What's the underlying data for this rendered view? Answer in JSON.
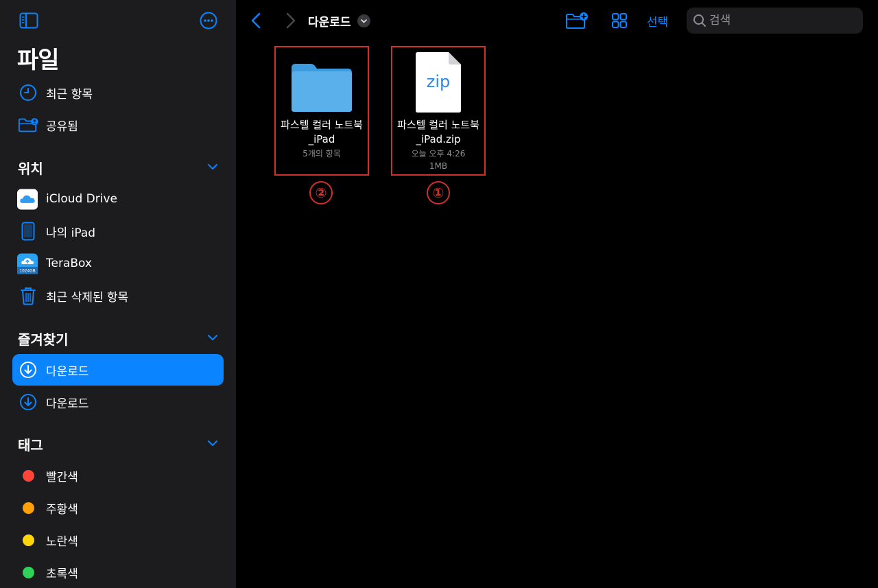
{
  "sidebar": {
    "title": "파일",
    "top_items": [
      {
        "label": "최근 항목",
        "icon": "clock-icon"
      },
      {
        "label": "공유됨",
        "icon": "shared-folder-icon"
      }
    ],
    "locations": {
      "title": "위치",
      "items": [
        {
          "label": "iCloud Drive",
          "icon": "icloud-icon"
        },
        {
          "label": "나의 iPad",
          "icon": "ipad-icon"
        },
        {
          "label": "TeraBox",
          "icon": "terabox-icon",
          "badge_text": "1024GB"
        },
        {
          "label": "최근 삭제된 항목",
          "icon": "trash-icon"
        }
      ]
    },
    "favorites": {
      "title": "즐겨찾기",
      "items": [
        {
          "label": "다운로드",
          "icon": "download-icon",
          "selected": true
        },
        {
          "label": "다운로드",
          "icon": "download-icon",
          "selected": false
        }
      ]
    },
    "tags": {
      "title": "태그",
      "items": [
        {
          "label": "빨간색",
          "color": "#ff453a"
        },
        {
          "label": "주황색",
          "color": "#ff9f0a"
        },
        {
          "label": "노란색",
          "color": "#ffd60a"
        },
        {
          "label": "초록색",
          "color": "#30d158"
        }
      ]
    }
  },
  "toolbar": {
    "breadcrumb": "다운로드",
    "select_label": "선택",
    "search_placeholder": "검색"
  },
  "files": [
    {
      "name_line1": "파스텔 컬러 노트북",
      "name_line2": "_iPad",
      "meta1": "5개의 항목",
      "meta2": "",
      "kind": "folder",
      "annotation": "②"
    },
    {
      "name_line1": "파스텔 컬러 노트북",
      "name_line2": "_iPad.zip",
      "meta1": "오늘 오후 4:26",
      "meta2": "1MB",
      "kind": "zip",
      "type_label": "zip",
      "annotation": "①"
    }
  ],
  "colors": {
    "accent": "#0a84ff",
    "sidebar_bg": "#1c1c1e",
    "annotation": "#d0302a",
    "folder": "#5ab0ea"
  }
}
